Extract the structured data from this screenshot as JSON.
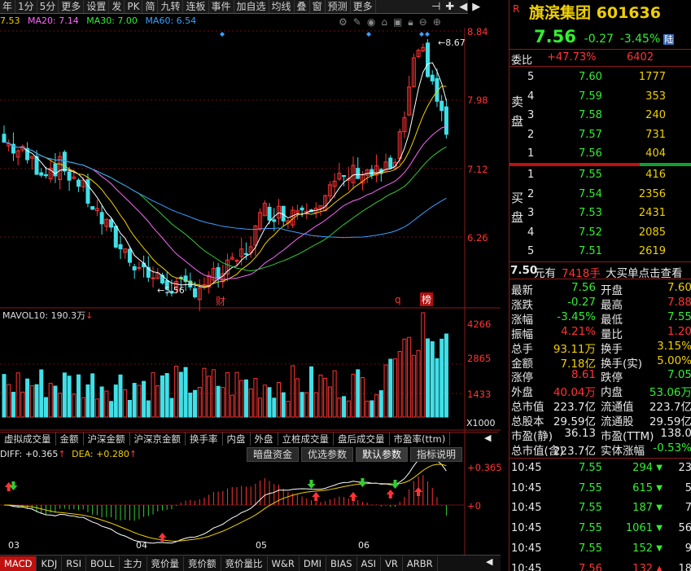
{
  "toolbar": {
    "items": [
      "年",
      "1分",
      "5分",
      "更多",
      "设置",
      "发",
      "PK",
      "简",
      "九转",
      "连板",
      "事件",
      "加自选",
      "均线",
      "叠",
      "窗",
      "预测",
      "更多"
    ]
  },
  "ma_legend": {
    "ma5": "7.53",
    "ma20": "MA20: 7.14",
    "ma30": "MA30: 7.00",
    "ma60": "MA60: 6.54"
  },
  "price_axis": [
    "8.84",
    "7.98",
    "7.12",
    "6.26"
  ],
  "chart_labels": {
    "high": "8.67",
    "low": "5.56",
    "cai": "财",
    "q": "q",
    "bang": "榜"
  },
  "volume": {
    "legend": "MAVOL10: 190.3万",
    "axis": [
      "4266",
      "2865",
      "1433",
      "X1000"
    ]
  },
  "indicator_tabs": [
    "虚拟成交量",
    "金额",
    "沪深金额",
    "沪深京金额",
    "换手率",
    "内盘",
    "外盘",
    "立桩成交量",
    "盘后成交量",
    "市盈率(ttm)"
  ],
  "macd": {
    "diff": "DIFF: +0.365",
    "dea": "DEA: +0.280",
    "axis": [
      "+0.365",
      "+0"
    ],
    "buttons": [
      "暗盘资金",
      "优选参数",
      "默认参数",
      "指标说明"
    ]
  },
  "date_labels": [
    "03",
    "04",
    "05",
    "06"
  ],
  "bottom_tabs": [
    "MACD",
    "KDJ",
    "RSI",
    "BOLL",
    "主力",
    "竞价量",
    "竞价额",
    "竞价量比",
    "W&R",
    "DMI",
    "BIAS",
    "ASI",
    "VR",
    "ARBR"
  ],
  "quote": {
    "name": "旗滨集团",
    "code": "601636",
    "price": "7.56",
    "change": "-0.27",
    "change_pct": "-3.45%",
    "market": "陆",
    "weibi_label": "委比",
    "weibi_value": "+47.73%",
    "weibi_diff": "6402",
    "sell_label": [
      "卖",
      "盘"
    ],
    "buy_label": [
      "买",
      "盘"
    ],
    "asks": [
      {
        "level": "5",
        "price": "7.60",
        "vol": "1777"
      },
      {
        "level": "4",
        "price": "7.59",
        "vol": "353"
      },
      {
        "level": "3",
        "price": "7.58",
        "vol": "240"
      },
      {
        "level": "2",
        "price": "7.57",
        "vol": "731"
      },
      {
        "level": "1",
        "price": "7.56",
        "vol": "404"
      }
    ],
    "bids": [
      {
        "level": "1",
        "price": "7.55",
        "vol": "416"
      },
      {
        "level": "2",
        "price": "7.54",
        "vol": "2356"
      },
      {
        "level": "3",
        "price": "7.53",
        "vol": "2431"
      },
      {
        "level": "4",
        "price": "7.52",
        "vol": "2085"
      },
      {
        "level": "5",
        "price": "7.51",
        "vol": "2619"
      }
    ],
    "big_order": {
      "price": "7.50",
      "text1": "元有",
      "qty": "7418手",
      "text2": "大买单点击查看"
    },
    "stats": [
      {
        "l1": "最新",
        "v1": "7.56",
        "l2": "开盘",
        "v2": "7.60"
      },
      {
        "l1": "涨跌",
        "v1": "-0.27",
        "l2": "最高",
        "v2": "7.88"
      },
      {
        "l1": "涨幅",
        "v1": "-3.45%",
        "l2": "最低",
        "v2": "7.55"
      },
      {
        "l1": "振幅",
        "v1": "4.21%",
        "l2": "量比",
        "v2": "1.20"
      },
      {
        "l1": "总手",
        "v1": "93.11万",
        "l2": "换手",
        "v2": "3.15%"
      },
      {
        "l1": "金额",
        "v1": "7.18亿",
        "l2": "换手(实)",
        "v2": "5.00%"
      },
      {
        "l1": "涨停",
        "v1": "8.61",
        "l2": "跌停",
        "v2": "7.05"
      },
      {
        "l1": "外盘",
        "v1": "40.04万",
        "l2": "内盘",
        "v2": "53.06万"
      },
      {
        "l1": "总市值",
        "v1": "223.7亿",
        "l2": "流通值",
        "v2": "223.7亿"
      },
      {
        "l1": "总股本",
        "v1": "29.59亿",
        "l2": "流通股",
        "v2": "29.59亿"
      },
      {
        "l1": "市盈(静)",
        "v1": "36.13",
        "l2": "市盈(TTM)",
        "v2": "138.0"
      },
      {
        "l1": "总市值(含)",
        "v1": "223.7亿",
        "l2": "实体涨幅",
        "v2": "-0.53%"
      }
    ],
    "trades": [
      {
        "time": "10:45",
        "price": "7.55",
        "vol": "294",
        "dir": "down",
        "n": "23"
      },
      {
        "time": "10:45",
        "price": "7.55",
        "vol": "615",
        "dir": "down",
        "n": "5"
      },
      {
        "time": "10:45",
        "price": "7.55",
        "vol": "187",
        "dir": "down",
        "n": "7"
      },
      {
        "time": "10:45",
        "price": "7.55",
        "vol": "1061",
        "dir": "down",
        "n": "56"
      },
      {
        "time": "10:45",
        "price": "7.55",
        "vol": "152",
        "dir": "down",
        "n": "9"
      },
      {
        "time": "10:45",
        "price": "7.56",
        "vol": "132",
        "dir": "up",
        "n": "18"
      }
    ]
  },
  "colors": {
    "up": "#ff3333",
    "down": "#40e0e8",
    "ma5": "#ffffff",
    "ma10": "#f0d000",
    "ma20": "#ff66ff",
    "ma30": "#33cc33",
    "ma60": "#3aa0ff"
  }
}
